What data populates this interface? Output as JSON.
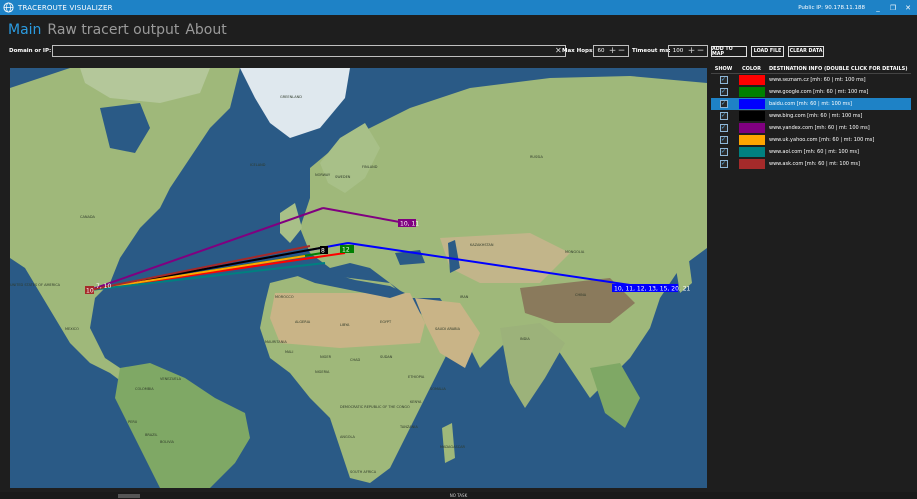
{
  "app": {
    "title": "TRACEROUTE VISUALIZER",
    "public_ip": "Public IP: 90.178.11.188"
  },
  "window_controls": {
    "minimize": "_",
    "restore": "❐",
    "close": "✕"
  },
  "nav": {
    "tabs": [
      {
        "label": "Main",
        "active": true
      },
      {
        "label": "Raw tracert output"
      },
      {
        "label": "About"
      }
    ]
  },
  "toolbar": {
    "domain_label": "Domain or IP:",
    "domain_value": "",
    "clear_glyph": "✕",
    "max_hops_label": "Max Hops:",
    "max_hops_value": "60",
    "timeout_label": "Timeout ms:",
    "timeout_value": "100",
    "plus": "+",
    "minus": "−",
    "add_to_map": "ADD TO MAP",
    "load_file": "LOAD FILE",
    "clear_data": "CLEAR DATA"
  },
  "panel": {
    "headers": {
      "show": "SHOW",
      "color": "COLOR",
      "info": "DESTINATION INFO (DOUBLE CLICK FOR DETAILS)"
    },
    "rows": [
      {
        "info": "www.seznam.cz [mh: 60 | mt: 100 ms]",
        "color": "#ff0000",
        "checked": true
      },
      {
        "info": "www.google.com [mh: 60 | mt: 100 ms]",
        "color": "#008000",
        "checked": true
      },
      {
        "info": "baidu.com [mh: 60 | mt: 100 ms]",
        "color": "#0000ff",
        "checked": true,
        "selected": true
      },
      {
        "info": "www.bing.com [mh: 60 | mt: 100 ms]",
        "color": "#000000",
        "checked": true
      },
      {
        "info": "www.yandex.com [mh: 60 | mt: 100 ms]",
        "color": "#800080",
        "checked": true
      },
      {
        "info": "www.uk.yahoo.com [mh: 60 | mt: 100 ms]",
        "color": "#ffa500",
        "checked": true
      },
      {
        "info": "www.aol.com [mh: 60 | mt: 100 ms]",
        "color": "#008080",
        "checked": true
      },
      {
        "info": "www.ask.com [mh: 60 | mt: 100 ms]",
        "color": "#a52a2a",
        "checked": true
      }
    ]
  },
  "map": {
    "colors": {
      "ocean": "#2a5a86",
      "land": "#9fb87a",
      "desert": "#c9b487",
      "ice": "#dfe8ee",
      "mountain": "#8a7a5c"
    },
    "labels": [
      "CANADA",
      "UNITED STATES OF AMERICA",
      "MEXICO",
      "BRAZIL",
      "RUSSIA",
      "KAZAKHSTAN",
      "CHINA",
      "INDIA",
      "ALGERIA",
      "LIBYA",
      "EGYPT",
      "NIGER",
      "CHAD",
      "SUDAN",
      "ETHIOPIA",
      "DEMOCRATIC REPUBLIC OF THE CONGO",
      "MONGOLIA",
      "IRAN",
      "SAUDI ARABIA",
      "MALI",
      "MAURITANIA",
      "ANGOLA",
      "SOUTH AFRICA",
      "GREENLAND",
      "SWEDEN",
      "FINLAND",
      "NORWAY",
      "ICELAND",
      "PERU",
      "BOLIVIA",
      "VENEZUELA",
      "COLOMBIA",
      "TANZANIA",
      "KENYA",
      "NIGERIA",
      "MOROCCO",
      "SOMALIA",
      "MADAGASCAR"
    ],
    "hop_labels": [
      "10, 11",
      "10, 11, 12, 13, 15, 20, 21",
      "10",
      "7, 10",
      "8",
      "12"
    ]
  },
  "status": {
    "text": "NO TASK"
  }
}
